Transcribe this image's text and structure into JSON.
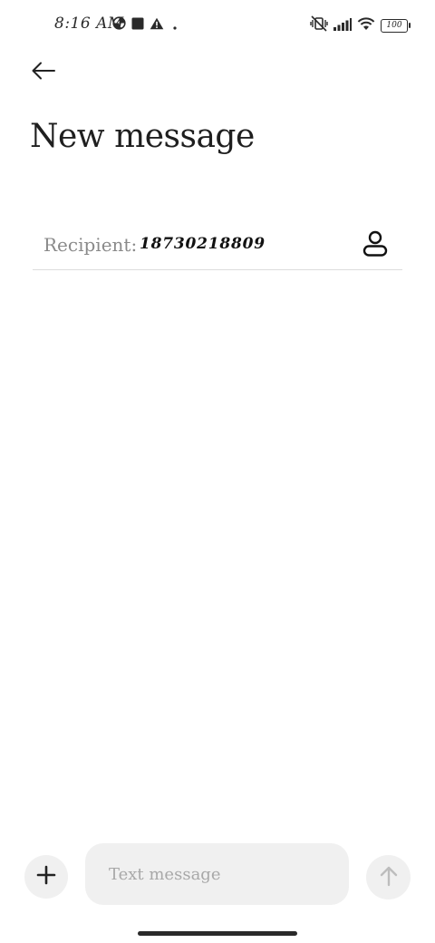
{
  "status_bar": {
    "time": "8:16 AM",
    "left_icons": [
      "data-saver-icon",
      "stop-square-icon",
      "warning-icon",
      "dot-icon"
    ],
    "right_icons": [
      "vibrate-off-icon",
      "signal-icon",
      "wifi-icon",
      "battery-icon"
    ],
    "battery_level": "100"
  },
  "header": {
    "back_icon": "back-arrow-icon",
    "title": "New message"
  },
  "recipient": {
    "label": "Recipient:",
    "value": "18730218809",
    "contact_icon": "contact-person-icon"
  },
  "composer": {
    "attach_icon": "plus-icon",
    "placeholder": "Text message",
    "value": "",
    "send_icon": "send-arrow-up-icon"
  },
  "colors": {
    "background": "#ffffff",
    "text_primary": "#1f1f1f",
    "text_muted": "#8a8a8a",
    "placeholder": "#a8a8a8",
    "surface": "#f0f0f0",
    "divider": "#dcdcdc",
    "send_disabled": "#bdbdbd"
  }
}
